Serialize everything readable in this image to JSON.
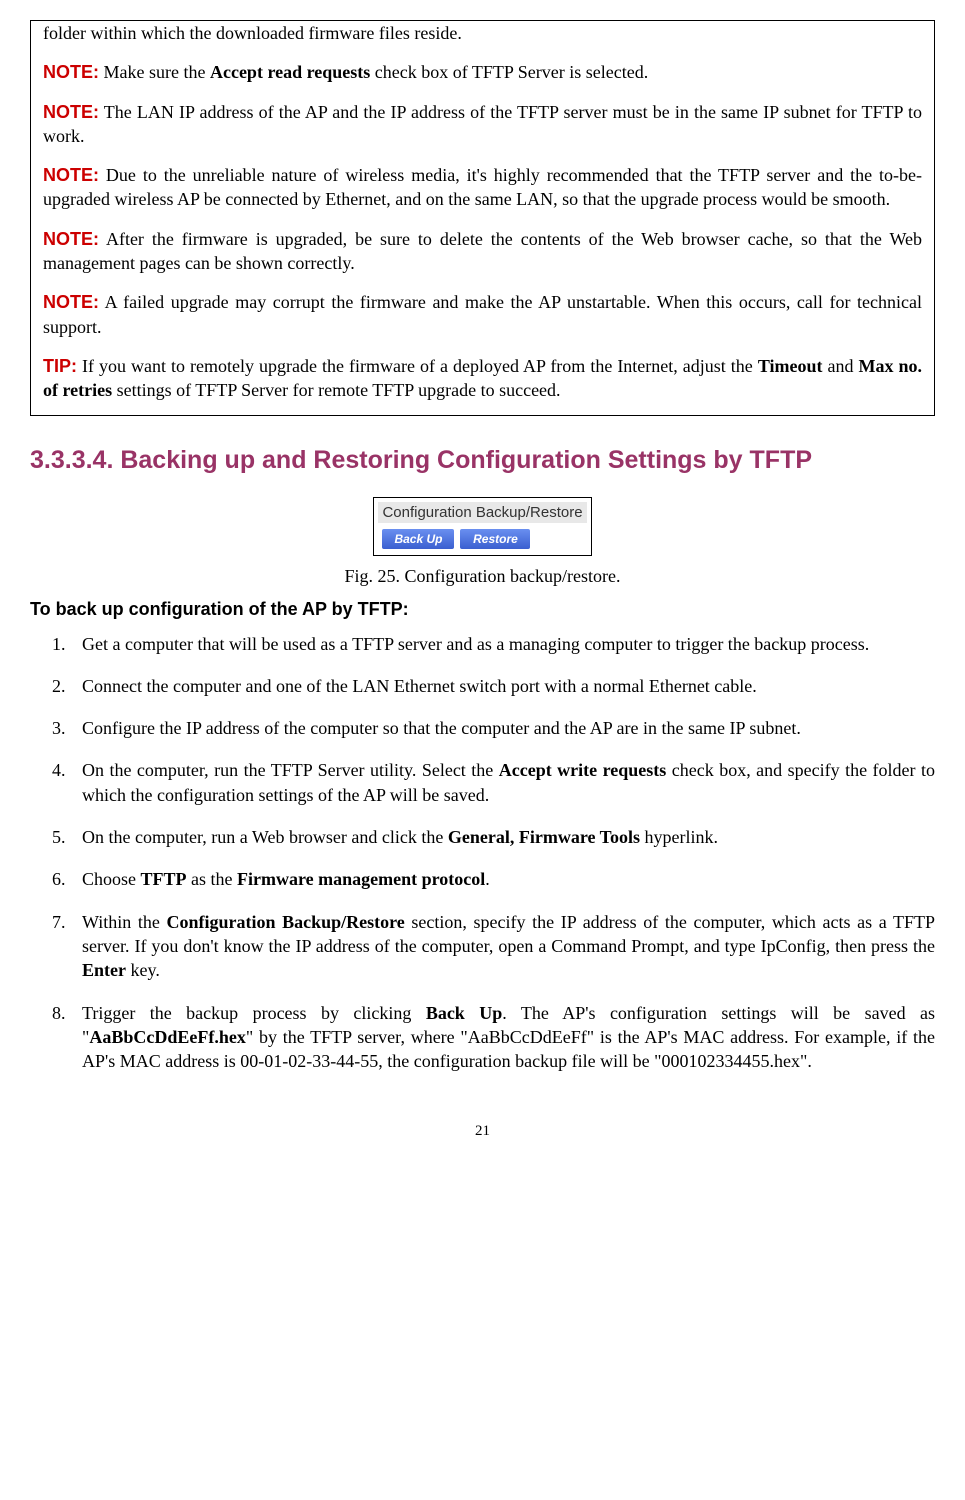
{
  "boxed": {
    "line0": "folder within which the downloaded firmware files reside.",
    "note1_label": "NOTE:",
    "note1_a": " Make sure the ",
    "note1_b": "Accept read requests",
    "note1_c": " check box of TFTP Server is selected.",
    "note2_label": "NOTE:",
    "note2": " The LAN IP address of the AP and the IP address of the TFTP server must be in the same IP subnet for TFTP to work.",
    "note3_label": "NOTE:",
    "note3": " Due to the unreliable nature of wireless media, it's highly recommended that the TFTP server and the to-be-upgraded wireless AP be connected by Ethernet, and on the same LAN, so that the upgrade process would be smooth.",
    "note4_label": "NOTE:",
    "note4": " After the firmware is upgraded, be sure to delete the contents of the Web browser cache, so that the Web management pages can be shown correctly.",
    "note5_label": "NOTE:",
    "note5": " A failed upgrade may corrupt the firmware and make the AP unstartable. When this occurs, call for technical support.",
    "tip_label": "TIP:",
    "tip_a": " If you want to remotely upgrade the firmware of a deployed AP from the Internet, adjust the ",
    "tip_b": "Timeout",
    "tip_c": " and ",
    "tip_d": "Max no. of retries",
    "tip_e": " settings of TFTP Server for remote TFTP upgrade to succeed."
  },
  "heading": "3.3.3.4. Backing up and Restoring Configuration Settings by TFTP",
  "figure": {
    "title": "Configuration Backup/Restore",
    "btn1": "Back Up",
    "btn2": "Restore"
  },
  "caption": "Fig. 25. Configuration backup/restore.",
  "subheading": "To back up configuration of the AP by TFTP:",
  "steps": {
    "s1": "Get a computer that will be used as a TFTP server and as a managing computer to trigger the backup process.",
    "s2": "Connect the computer and one of the LAN Ethernet switch port with a normal Ethernet cable.",
    "s3": "Configure the IP address of the computer so that the computer and the AP are in the same IP subnet.",
    "s4_a": "On the computer, run the TFTP Server utility. Select the ",
    "s4_b": "Accept write requests",
    "s4_c": " check box, and specify the folder to which the configuration settings of the AP will be saved.",
    "s5_a": "On the computer, run a Web browser and click the ",
    "s5_b": "General, Firmware Tools",
    "s5_c": " hyperlink.",
    "s6_a": "Choose ",
    "s6_b": "TFTP",
    "s6_c": " as the ",
    "s6_d": "Firmware management protocol",
    "s6_e": ".",
    "s7_a": "Within the ",
    "s7_b": "Configuration Backup/Restore",
    "s7_c": " section, specify the IP address of the computer, which acts as a TFTP server. If you don't know the IP address of the computer, open a Command Prompt, and type IpConfig, then press the ",
    "s7_d": "Enter",
    "s7_e": " key.",
    "s8_a": "Trigger the backup process by clicking ",
    "s8_b": "Back Up",
    "s8_c": ". The AP's configuration settings will be saved as \"",
    "s8_d": "AaBbCcDdEeFf.hex",
    "s8_e": "\" by the TFTP server, where \"AaBbCcDdEeFf\" is the AP's MAC address. For example, if the AP's MAC address is 00-01-02-33-44-55, the configuration backup file will be \"000102334455.hex\"."
  },
  "pagenum": "21"
}
